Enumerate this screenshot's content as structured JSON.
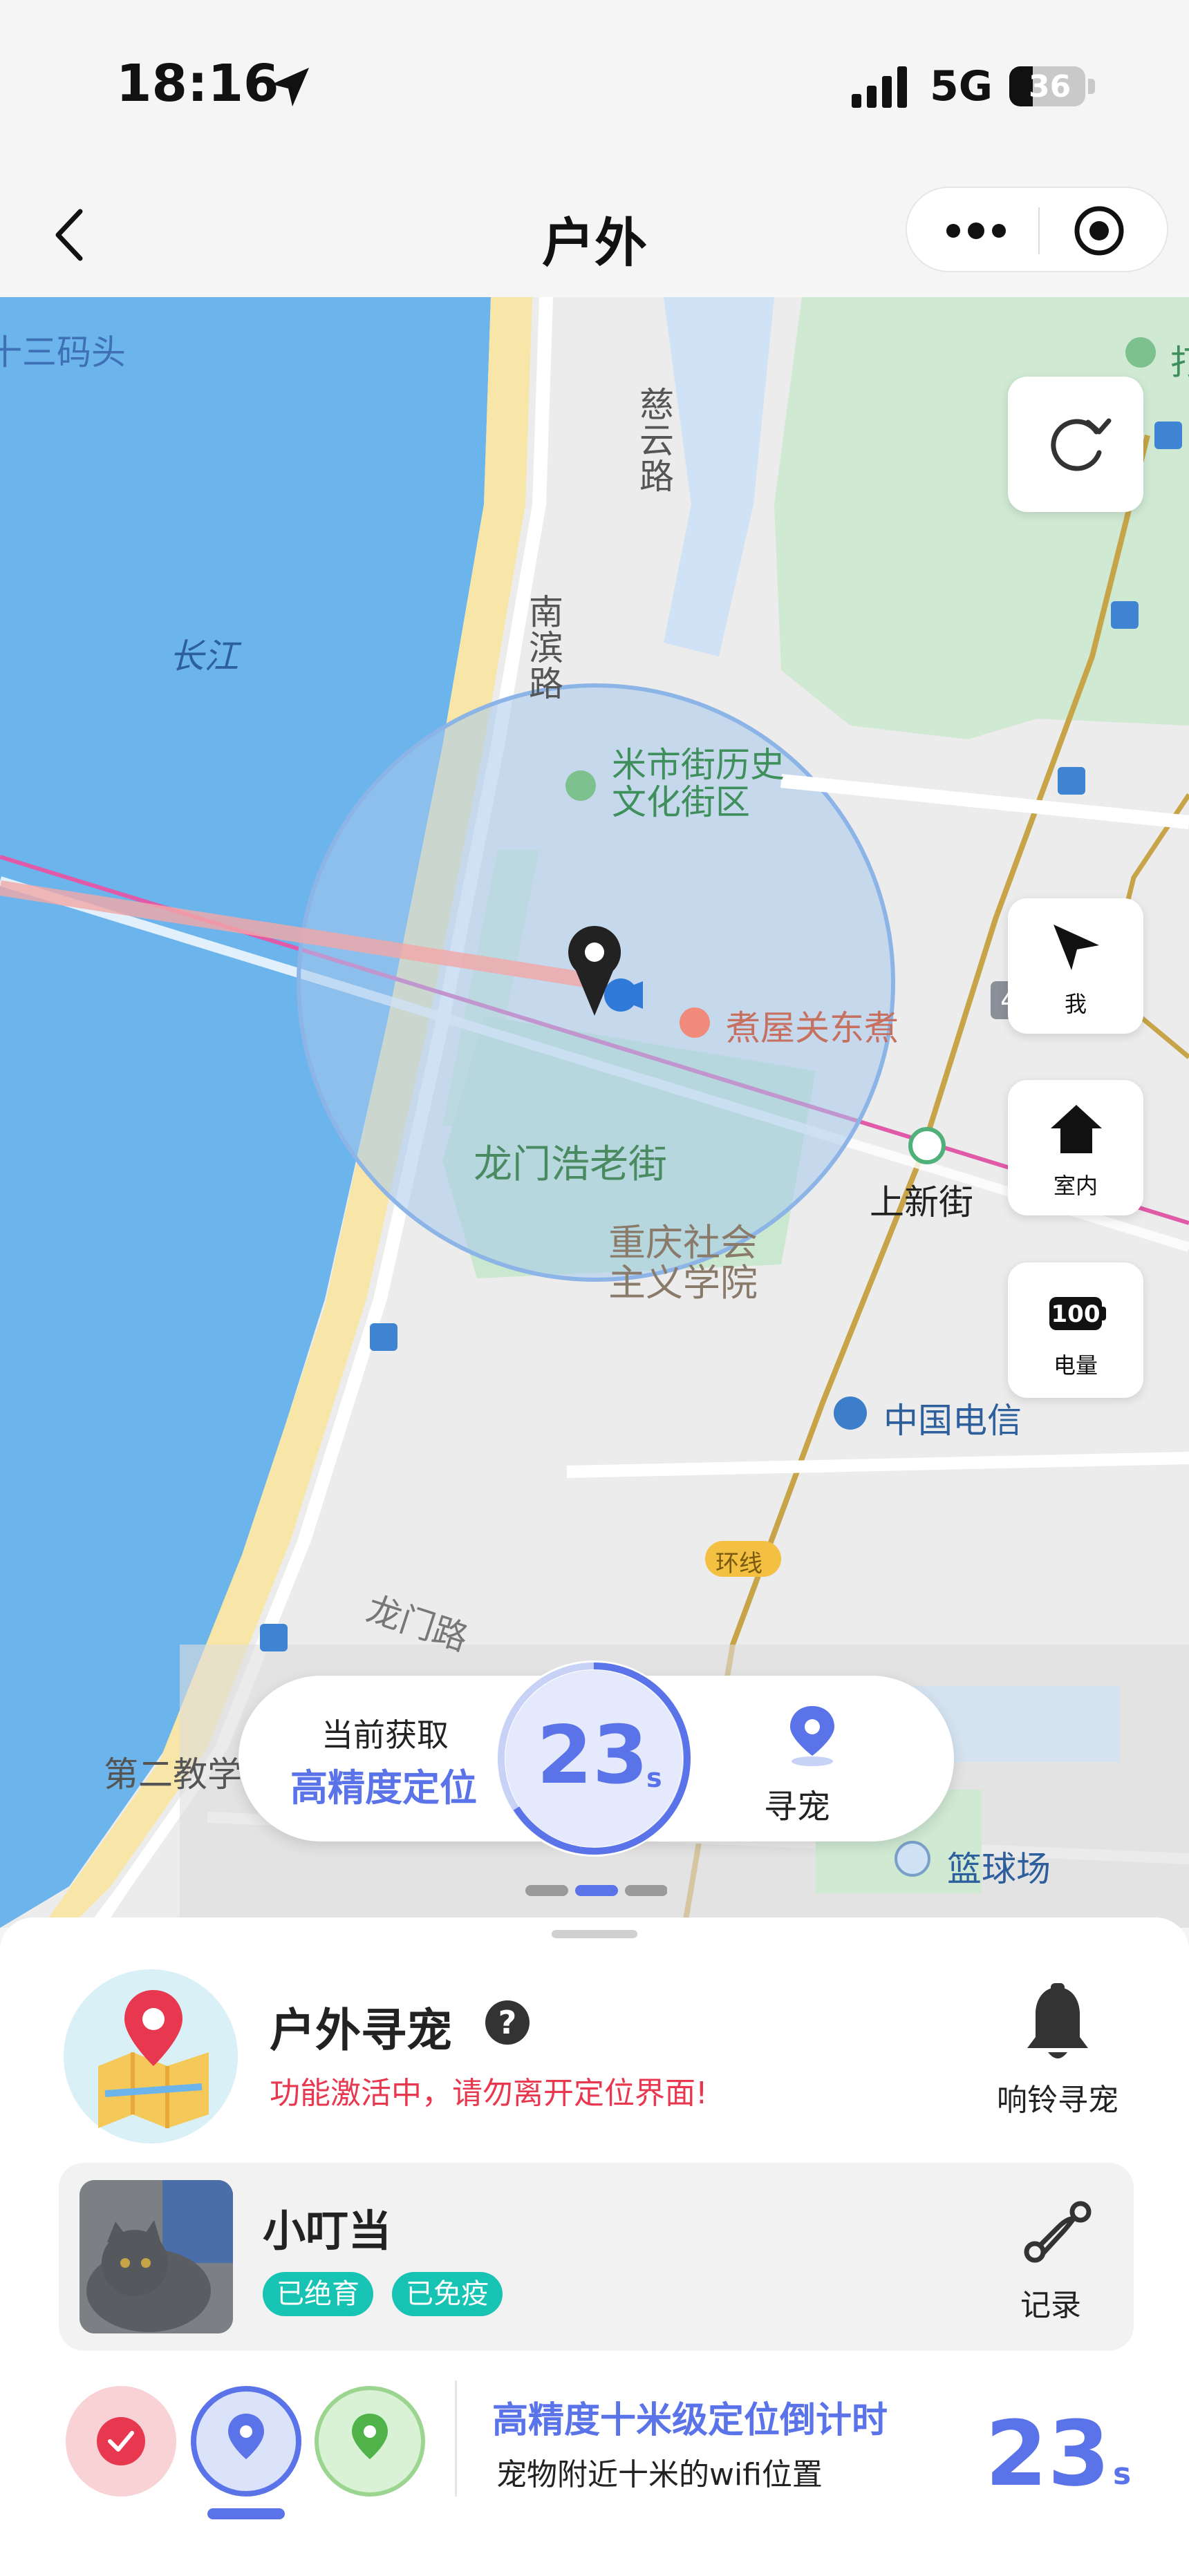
{
  "status_bar": {
    "time": "18:16",
    "network": "5G",
    "battery": "36"
  },
  "nav": {
    "title": "户外"
  },
  "map": {
    "labels": {
      "pier": "十三码头",
      "river": "长江",
      "road_ciyun": "慈云路",
      "road_nanbin": "南滨路",
      "historic": "米市街历史\n文化街区",
      "restaurant": "煮屋关东煮",
      "old_street": "龙门浩老街",
      "station": "上新街",
      "academy": "重庆社会\n主义学院",
      "telecom": "中国电信",
      "ring_line": "环线",
      "road_longmen": "龙门路",
      "school": "第二教学",
      "court": "篮球场",
      "line_no": "4",
      "edge_char": "打"
    },
    "buttons": {
      "me": "我",
      "indoor": "室内",
      "battery_label": "电量",
      "battery_value": "100"
    }
  },
  "countdown_pill": {
    "line1": "当前获取",
    "line2": "高精度定位",
    "seconds": "23",
    "unit": "s",
    "find_label": "寻宠"
  },
  "sheet": {
    "title": "户外寻宠",
    "warning": "功能激活中，请勿离开定位界面!",
    "bell_label": "响铃寻宠",
    "pet": {
      "name": "小叮当",
      "tags": [
        "已绝育",
        "已免疫"
      ],
      "record_label": "记录"
    },
    "info": {
      "title": "高精度十米级定位倒计时",
      "subtitle": "宠物附近十米的wifi位置",
      "seconds": "23",
      "unit": "s"
    }
  },
  "colors": {
    "accent": "#5a73e8",
    "water": "#6bb4ec",
    "park": "#c9e8cf",
    "warning": "#e8384f",
    "tag": "#17c3b2"
  }
}
